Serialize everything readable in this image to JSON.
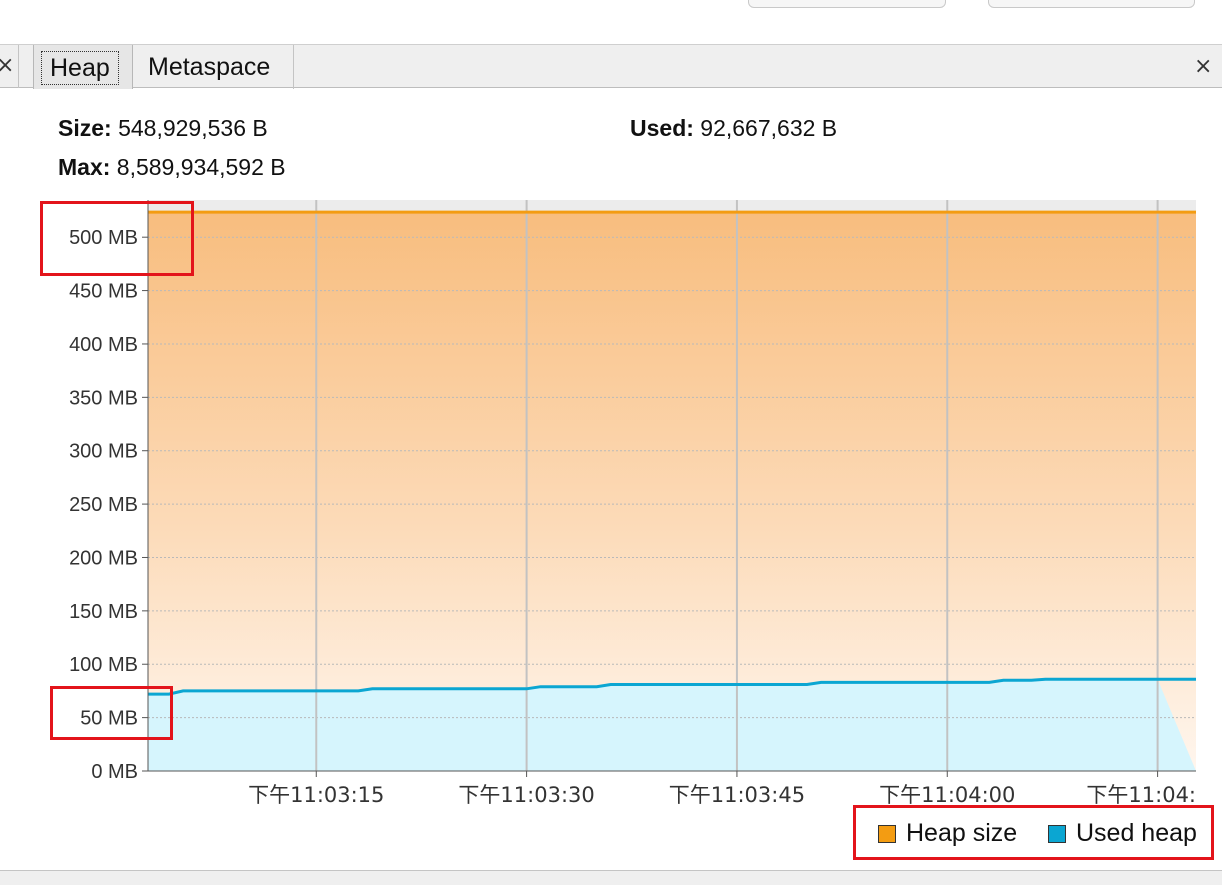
{
  "tabs": [
    {
      "label": "Heap",
      "selected": true
    },
    {
      "label": "Metaspace",
      "selected": false
    }
  ],
  "close_glyph": "×",
  "info": {
    "size_label": "Size:",
    "size_value": "548,929,536 B",
    "used_label": "Used:",
    "used_value": "92,667,632 B",
    "max_label": "Max:",
    "max_value": "8,589,934,592 B"
  },
  "chart_data": {
    "type": "area",
    "y_ticks": [
      "0 MB",
      "50 MB",
      "100 MB",
      "150 MB",
      "200 MB",
      "250 MB",
      "300 MB",
      "350 MB",
      "400 MB",
      "450 MB",
      "500 MB"
    ],
    "y_tick_values": [
      0,
      50,
      100,
      150,
      200,
      250,
      300,
      350,
      400,
      450,
      500
    ],
    "ylim": [
      0,
      525
    ],
    "xlim_seconds": [
      3,
      54.6
    ],
    "x_ticks": [
      "下午11:03:15",
      "下午11:03:30",
      "下午11:03:45",
      "下午11:04:00",
      "下午11:04:"
    ],
    "x_tick_seconds": [
      15,
      30,
      45,
      60,
      75
    ],
    "grid": true,
    "legend_position": "bottom-right",
    "series": [
      {
        "name": "Heap size",
        "color": "#f39c12",
        "x": [
          3,
          75
        ],
        "y": [
          523.5,
          523.5
        ]
      },
      {
        "name": "Used heap",
        "color": "#0ba6d2",
        "x": [
          3,
          4.5,
          5.5,
          18,
          19,
          30,
          31,
          35,
          36,
          50,
          51,
          63,
          64,
          66,
          67,
          75
        ],
        "y": [
          72,
          72,
          75,
          75,
          77,
          77,
          79,
          79,
          81,
          81,
          83,
          83,
          85,
          85,
          86,
          86
        ]
      }
    ]
  },
  "colors": {
    "heap_line": "#f39c12",
    "used_line": "#0ba6d2",
    "highlight": "#e3141b"
  }
}
